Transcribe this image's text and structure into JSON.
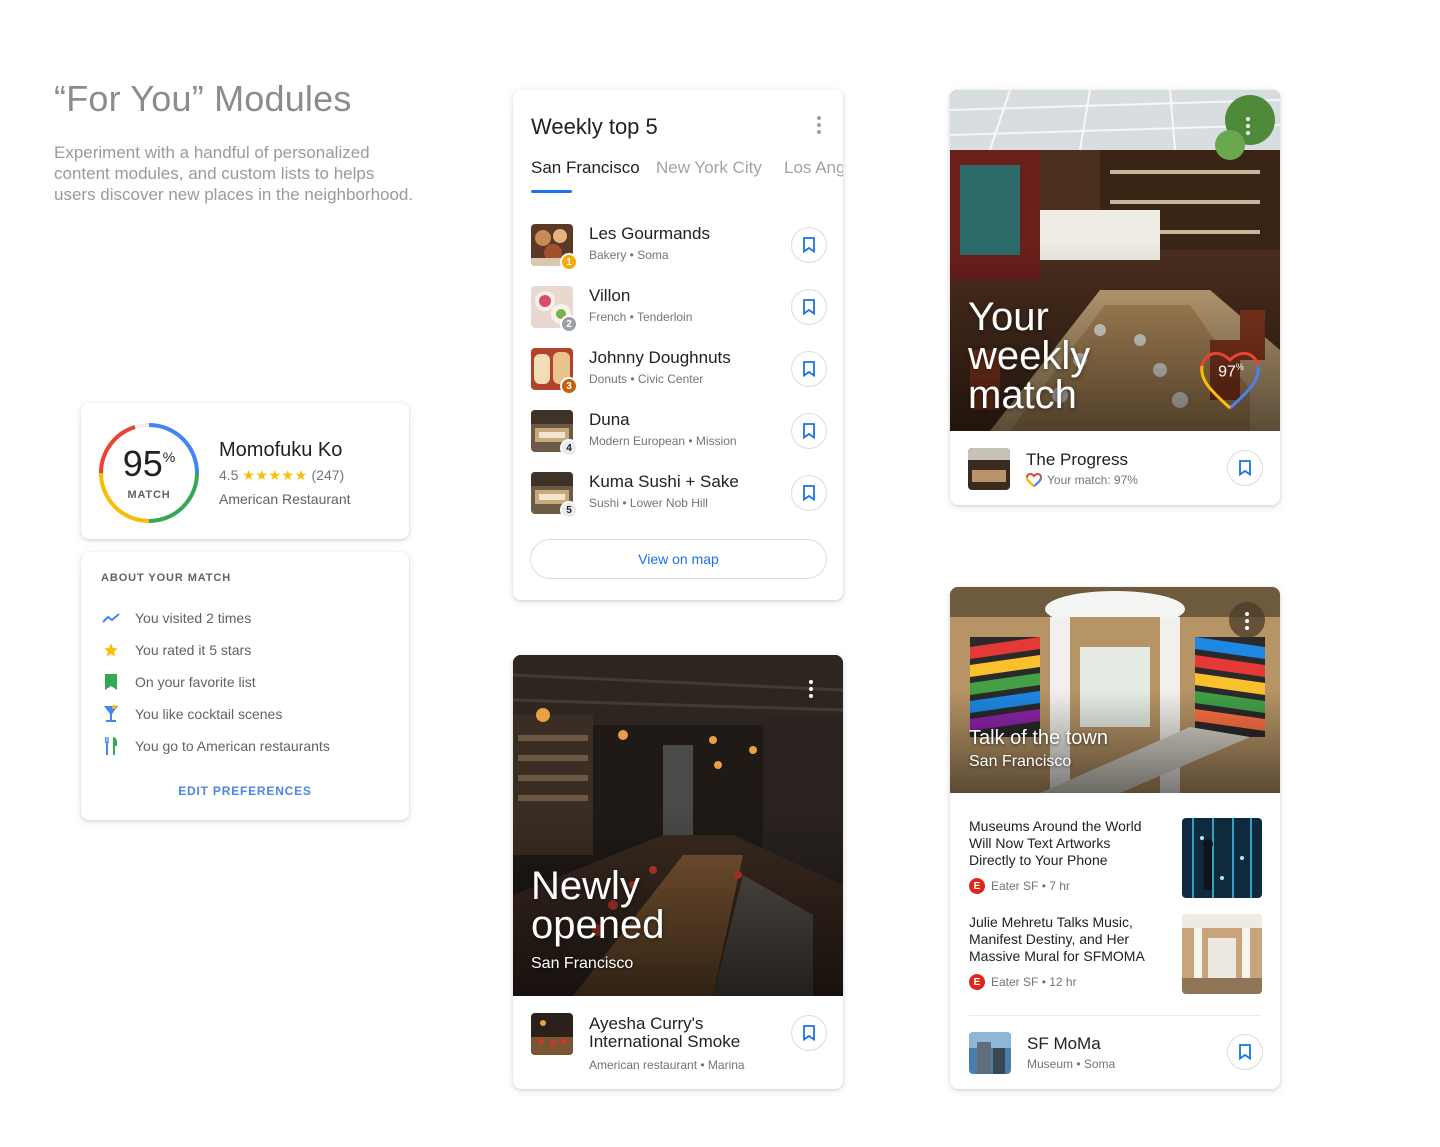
{
  "intro": {
    "title": "“For You” Modules",
    "description": "Experiment with a handful of personalized content modules, and custom lists to helps users discover new places in the neighborhood."
  },
  "match_card": {
    "percent": "95",
    "percent_sign": "%",
    "match_label": "MATCH",
    "match_fraction": 0.95,
    "name": "Momofuku Ko",
    "rating": "4.5",
    "stars": "★★★★★",
    "review_count": "(247)",
    "category": "American Restaurant"
  },
  "about": {
    "heading": "ABOUT YOUR MATCH",
    "items": [
      {
        "icon": "trend-line-icon",
        "text": "You visited 2 times"
      },
      {
        "icon": "star-icon",
        "text": "You rated it 5 stars"
      },
      {
        "icon": "bookmark-icon",
        "text": "On your favorite list"
      },
      {
        "icon": "cocktail-icon",
        "text": "You like cocktail scenes"
      },
      {
        "icon": "utensils-icon",
        "text": "You go to American restaurants"
      }
    ],
    "edit_label": "EDIT PREFERENCES"
  },
  "weekly": {
    "title": "Weekly top 5",
    "tabs": [
      "San Francisco",
      "New York City",
      "Los Angeles"
    ],
    "active_tab": "San Francisco",
    "items": [
      {
        "rank": "1",
        "name": "Les Gourmands",
        "sub": "Bakery • Soma",
        "rank_color": "#f9ab00"
      },
      {
        "rank": "2",
        "name": "Villon",
        "sub": "French • Tenderloin",
        "rank_color": "#9aa0a6"
      },
      {
        "rank": "3",
        "name": "Johnny Doughnuts",
        "sub": "Donuts • Civic Center",
        "rank_color": "#c5620d"
      },
      {
        "rank": "4",
        "name": "Duna",
        "sub": "Modern European • Mission",
        "rank_color": "#5f6368"
      },
      {
        "rank": "5",
        "name": "Kuma Sushi + Sake",
        "sub": "Sushi • Lower Nob Hill",
        "rank_color": "#5f6368"
      }
    ],
    "view_map_label": "View on map"
  },
  "weekly_match": {
    "hero_line1": "Your",
    "hero_line2": "weekly",
    "hero_line3": "match",
    "heart_percent": "97",
    "heart_sign": "%",
    "place_name": "The Progress",
    "match_text": "Your match: 97%"
  },
  "newly_opened": {
    "hero_line1": "Newly",
    "hero_line2": "opened",
    "location": "San Francisco",
    "place_name_line1": "Ayesha Curry's",
    "place_name_line2": "International Smoke",
    "place_sub": "American restaurant • Marina"
  },
  "talk": {
    "title": "Talk of the town",
    "location": "San Francisco",
    "news": [
      {
        "title": "Museums Around the World Will Now Text Artworks Directly to Your Phone",
        "source": "Eater SF",
        "time": "7 hr",
        "source_badge": "E"
      },
      {
        "title": "Julie Mehretu Talks Music, Manifest Destiny, and Her Massive Mural for SFMOMA",
        "source": "Eater SF",
        "time": "12 hr",
        "source_badge": "E"
      }
    ],
    "place_name": "SF MoMa",
    "place_sub": "Museum • Soma"
  },
  "colors": {
    "accent_blue": "#1a73e8",
    "ring_blue": "#4285f4",
    "ring_green": "#34a853",
    "ring_yellow": "#fbbc04",
    "ring_red": "#ea4335",
    "eater_red": "#e0261b"
  }
}
